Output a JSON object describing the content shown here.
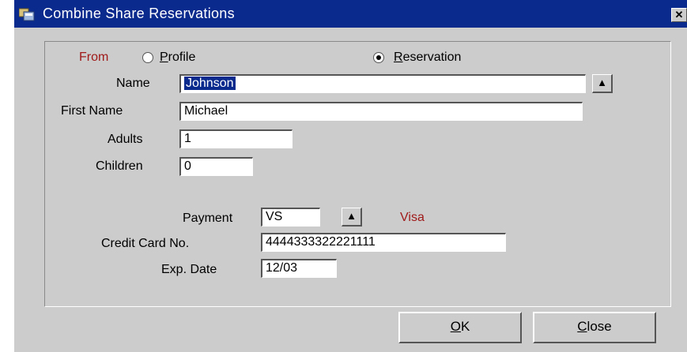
{
  "window": {
    "title": "Combine Share Reservations",
    "close_glyph": "✕"
  },
  "form": {
    "from_label": "From",
    "profile_label": "Profile",
    "reservation_label": "Reservation",
    "selected_source": "Reservation",
    "name_label": "Name",
    "name_value": "Johnson",
    "first_name_label": "First Name",
    "first_name_value": "Michael",
    "adults_label": "Adults",
    "adults_value": "1",
    "children_label": "Children",
    "children_value": "0",
    "payment_label": "Payment",
    "payment_value": "VS",
    "payment_desc": "Visa",
    "credit_card_label": "Credit Card No.",
    "credit_card_value": "4444333322221111",
    "exp_date_label": "Exp. Date",
    "exp_date_value": "12/03",
    "lov_glyph": "▲"
  },
  "buttons": {
    "ok_label": "OK",
    "close_label": "Close"
  },
  "colors": {
    "titlebar": "#0a2a8e",
    "label_accent": "#a01a1a",
    "window_bg": "#cccccc"
  },
  "icons": {
    "title": "app-window-icon",
    "list_of_values": "lov-arrow-icon"
  }
}
